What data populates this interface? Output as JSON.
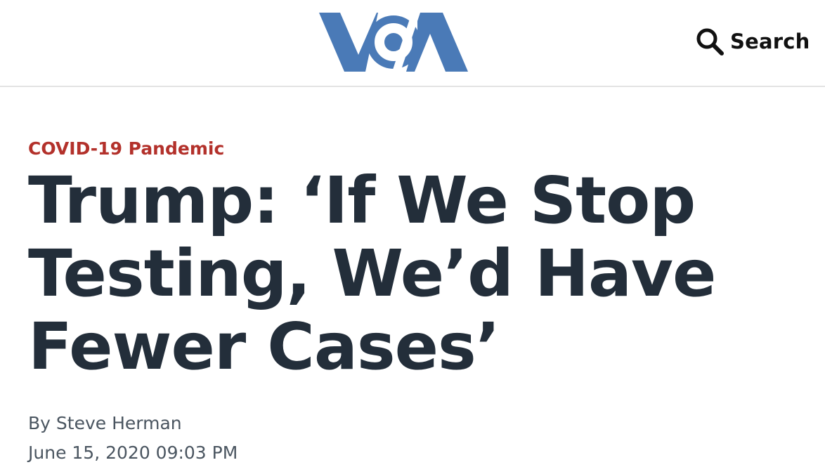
{
  "header": {
    "brand": "VOA",
    "brand_color": "#4a7ab7",
    "search_label": "Search",
    "search_icon": "magnifier-icon"
  },
  "article": {
    "category": "COVID-19 Pandemic",
    "category_color": "#b3312b",
    "headline_line1": "Trump: ‘If We Stop",
    "headline_line2": "Testing, We’d Have",
    "headline_line3": "Fewer Cases’",
    "byline_prefix": "By",
    "author": "Steve Herman",
    "date": "June 15, 2020 09:03 PM"
  }
}
